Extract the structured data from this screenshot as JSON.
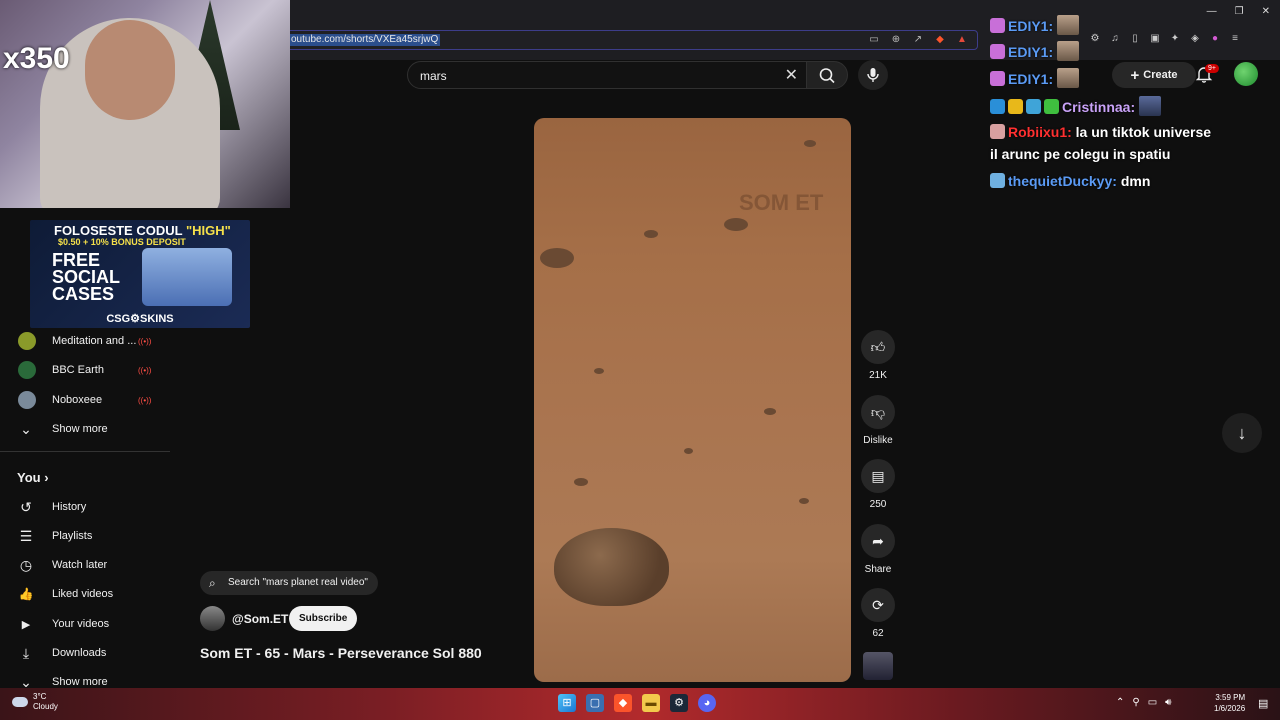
{
  "browser": {
    "url": "outube.com/shorts/VXEa45srjwQ"
  },
  "overlay": {
    "viewer_count": "x350",
    "promo": {
      "line1_prefix": "FOLOSESTE CODUL",
      "line1_code": "\"HIGH\"",
      "line2": "$0.50 + 10% BONUS DEPOSIT",
      "free_text": "FREE SOCIAL CASES",
      "brand": "CSG⚙SKINS"
    }
  },
  "header": {
    "search_value": "mars",
    "create_label": "Create",
    "notifications_badge": "9+"
  },
  "sidebar": {
    "subscriptions": [
      {
        "label": "Meditation and ...",
        "live": "((•))",
        "color": "#8a9a2a"
      },
      {
        "label": "BBC Earth",
        "live": "((•))",
        "color": "#2a6a3a"
      },
      {
        "label": "Noboxeee",
        "live": "((•))",
        "color": "#7a8a9a"
      }
    ],
    "show_more_1": "Show more",
    "you_title": "You",
    "you_chevron": "›",
    "you_items": [
      {
        "label": "History",
        "icon": "↺"
      },
      {
        "label": "Playlists",
        "icon": "☰"
      },
      {
        "label": "Watch later",
        "icon": "◷"
      },
      {
        "label": "Liked videos",
        "icon": "👍"
      },
      {
        "label": "Your videos",
        "icon": "▶"
      },
      {
        "label": "Downloads",
        "icon": "⤓"
      }
    ],
    "show_more_2": "Show more"
  },
  "short": {
    "watermark": "SOM ET",
    "search_chip": "Search \"mars planet real video\"",
    "channel": "@Som.ET",
    "subscribe_label": "Subscribe",
    "title": "Som ET - 65 - Mars - Perseverance Sol 880",
    "actions": {
      "likes": "21K",
      "dislike_label": "Dislike",
      "comments": "250",
      "share_label": "Share",
      "remix": "62"
    }
  },
  "chat": [
    {
      "user": "EDIY1:",
      "color": "#5b9bf5",
      "text": "",
      "emote": true
    },
    {
      "user": "EDIY1:",
      "color": "#5b9bf5",
      "text": "",
      "emote": true
    },
    {
      "user": "EDIY1:",
      "color": "#5b9bf5",
      "text": "",
      "emote": true
    },
    {
      "user": "Cristinnaa:",
      "color": "#c9a2f7",
      "text": "",
      "emote": true
    },
    {
      "user": "Robiixu1:",
      "color": "#ff3030",
      "text": "la un tiktok universe",
      "emote": false
    },
    {
      "user": "",
      "color": "#ffffff",
      "text": "il arunc pe colegu in spatiu",
      "emote": false
    },
    {
      "user": "thequietDuckyy:",
      "color": "#5b9bf5",
      "text": "dmn",
      "emote": false
    }
  ],
  "taskbar": {
    "temperature": "3°C",
    "condition": "Cloudy",
    "time": "3:59 PM",
    "date": "1/6/2026"
  }
}
